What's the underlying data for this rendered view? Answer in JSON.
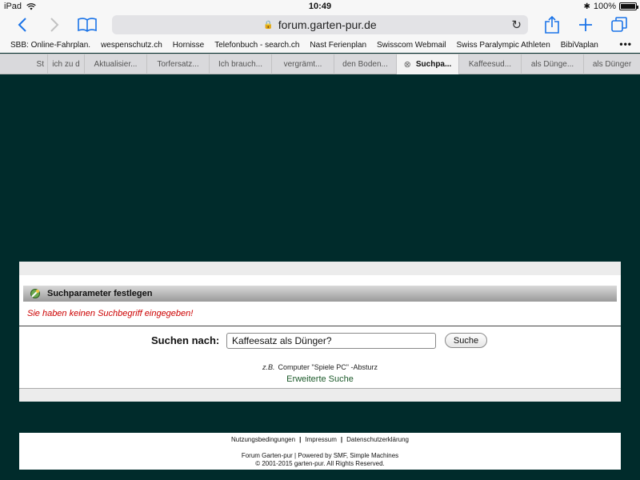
{
  "status_bar": {
    "device": "iPad",
    "time": "10:49",
    "battery": "100%"
  },
  "toolbar": {
    "url": "forum.garten-pur.de"
  },
  "bookmarks": [
    "SBB: Online-Fahrplan.",
    "wespenschutz.ch",
    "Hornisse",
    "Telefonbuch - search.ch",
    "Nast Ferienplan",
    "Swisscom Webmail",
    "Swiss Paralympic Athleten",
    "BibiVaplan"
  ],
  "tabs": [
    {
      "label": "St"
    },
    {
      "label": "ich zu d"
    },
    {
      "label": "Aktualisier..."
    },
    {
      "label": "Torfersatz..."
    },
    {
      "label": "Ich brauch..."
    },
    {
      "label": "vergrämt..."
    },
    {
      "label": "den Boden..."
    },
    {
      "label": "Suchpa..."
    },
    {
      "label": "Kaffeesud..."
    },
    {
      "label": "als Dünge..."
    },
    {
      "label": "als Dünger"
    }
  ],
  "search_panel": {
    "heading": "Suchparameter festlegen",
    "error": "Sie haben keinen Suchbegriff eingegeben!",
    "label": "Suchen nach:",
    "input_value": "Kaffeesatz als Dünger?",
    "button_label": "Suche",
    "example_prefix": "z.B.",
    "example_text": "Computer \"Spiele PC\" -Absturz",
    "advanced_link": "Erweiterte Suche"
  },
  "footer": {
    "links": [
      "Nutzungsbedingungen",
      "Impressum",
      "Datenschutzerklärung"
    ],
    "line2": "Forum Garten-pur | Powered by SMF, Simple Machines",
    "line3": "© 2001-2015 garten-pur. All Rights Reserved."
  },
  "colors": {
    "page_background": "#002b2b",
    "ios_blue": "#1a73e8",
    "error_red": "#cc0000",
    "link_green": "#1c5a2a"
  }
}
